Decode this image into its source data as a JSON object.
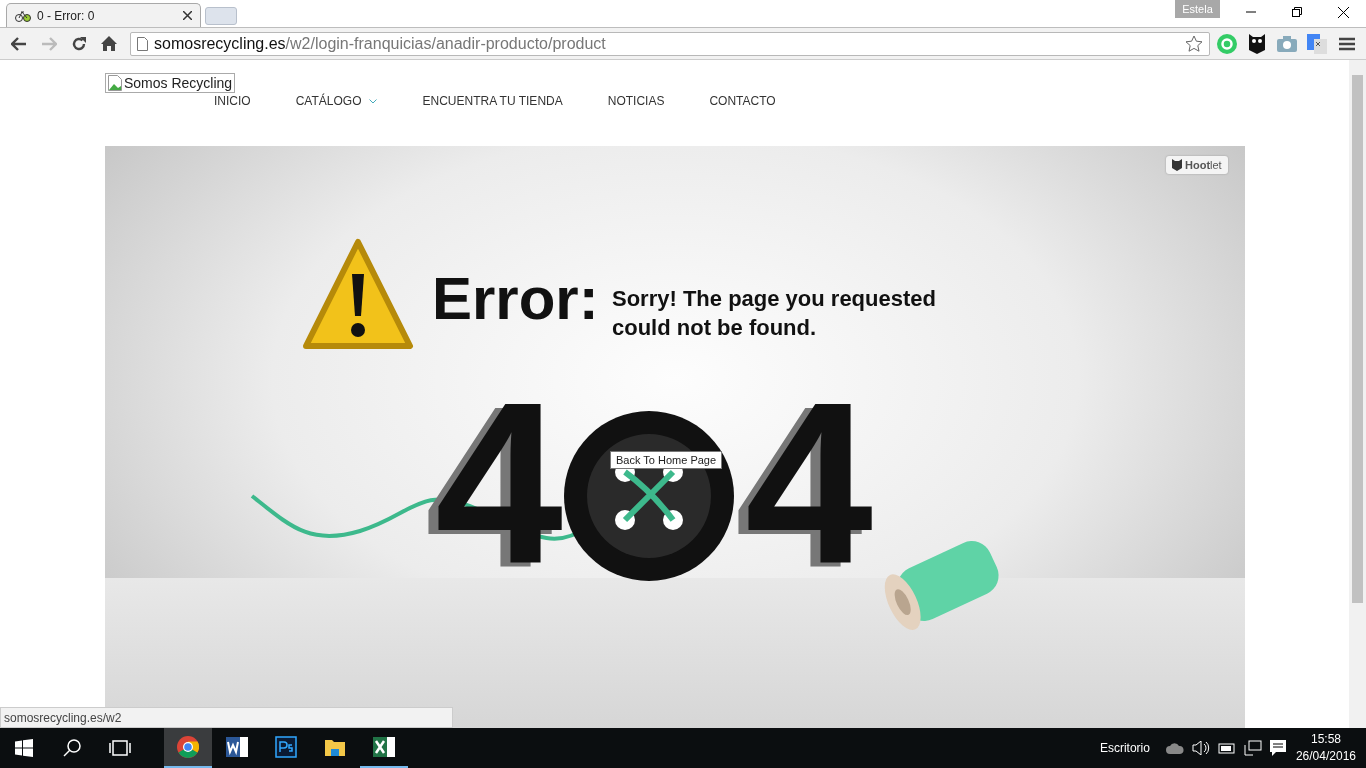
{
  "browser": {
    "tab": {
      "title": "0 - Error: 0",
      "selected": true
    },
    "profile": "Estela",
    "address": {
      "host": "somosrecycling.es",
      "path": "/w2/login-franquicias/anadir-producto/product"
    }
  },
  "site": {
    "logo_alt": "Somos Recycling",
    "nav": [
      {
        "label": "INICIO",
        "dropdown": false
      },
      {
        "label": "CATÁLOGO",
        "dropdown": true
      },
      {
        "label": "ENCUENTRA TU TIENDA",
        "dropdown": false
      },
      {
        "label": "NOTICIAS",
        "dropdown": false
      },
      {
        "label": "CONTACTO",
        "dropdown": false
      }
    ]
  },
  "error_image": {
    "badge": "**Hoot**let",
    "heading": "Error:",
    "message": "Sorry! The page you requested could not be found.",
    "code_digits": [
      "4",
      "4"
    ],
    "tooltip": "Back To Home Page"
  },
  "status_bar": "somosrecycling.es/w2",
  "taskbar": {
    "apps": [
      {
        "kind": "chrome",
        "selected": true,
        "running": true
      },
      {
        "kind": "word",
        "selected": false,
        "running": false
      },
      {
        "kind": "photoshop",
        "selected": false,
        "running": false
      },
      {
        "kind": "folder",
        "selected": false,
        "running": false
      },
      {
        "kind": "excel",
        "selected": false,
        "running": true
      }
    ],
    "desktop_label": "Escritorio",
    "time": "15:58",
    "date": "26/04/2016"
  }
}
